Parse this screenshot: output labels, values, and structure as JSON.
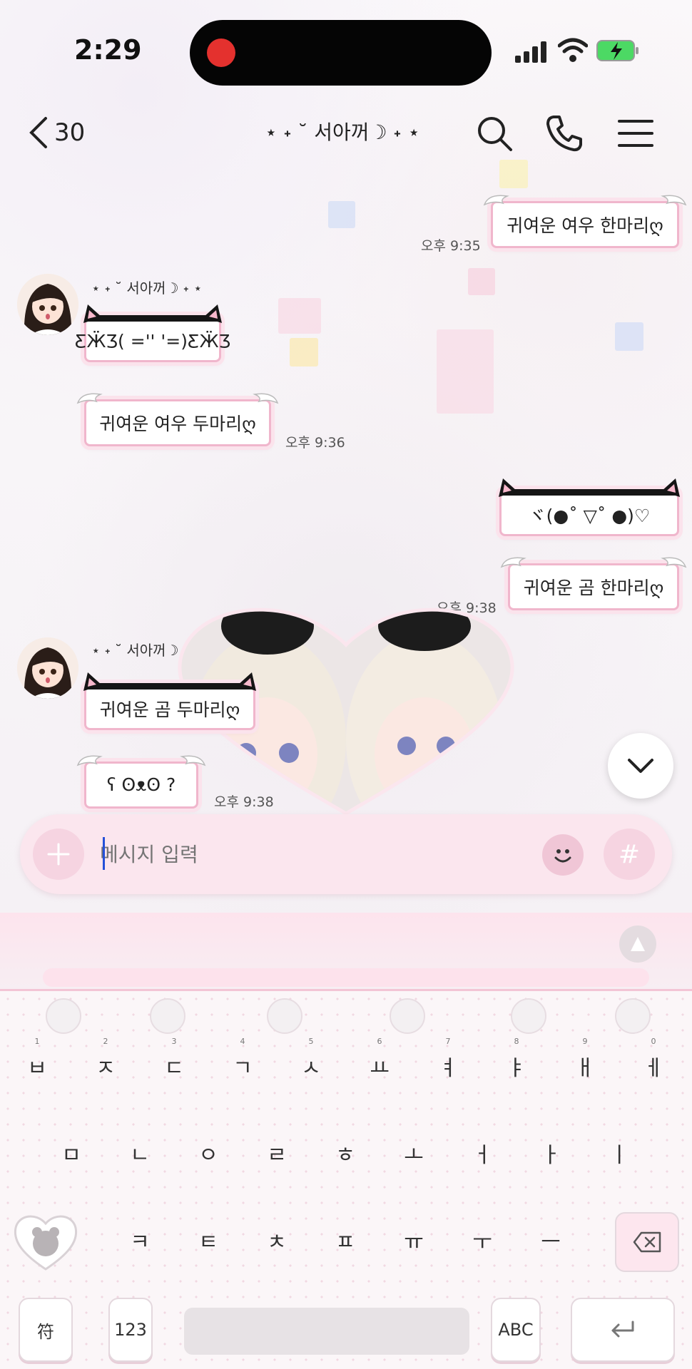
{
  "status_bar": {
    "time": "2:29"
  },
  "header": {
    "back_count": "30",
    "title": "⋆ ˖ ˘ 서아꺼☽ ˖ ⋆"
  },
  "messages": [
    {
      "id": "m1",
      "side": "right",
      "text": "귀여운 여우 한마리ღ",
      "time": "오후 9:35",
      "style": "wing"
    },
    {
      "id": "m2",
      "side": "left",
      "sender": "⋆ ˖ ˘ 서아꺼☽ ˖ ⋆",
      "text": "ƸӜƷ( ='' '=)ƸӜƷ",
      "style": "cat"
    },
    {
      "id": "m3",
      "side": "left",
      "text": "귀여운 여우 두마리ღ",
      "time": "오후 9:36",
      "style": "wing"
    },
    {
      "id": "m4",
      "side": "right",
      "text": "ヾ(●˚ ▽˚ ●)♡",
      "style": "cat"
    },
    {
      "id": "m5",
      "side": "right",
      "text": "귀여운 곰 한마리ღ",
      "time": "오후 9:38",
      "style": "wing"
    },
    {
      "id": "m6",
      "side": "left",
      "sender": "⋆ ˖ ˘ 서아꺼☽",
      "text": "귀여운 곰 두마리ღ",
      "style": "cat"
    },
    {
      "id": "m7",
      "side": "left",
      "text": "ʕ ʘᴥʘ ?",
      "time": "오후 9:38",
      "style": "wing"
    }
  ],
  "input": {
    "placeholder": "메시지 입력",
    "hash": "#"
  },
  "keyboard": {
    "row1": [
      {
        "hint": "1",
        "key": "ㅂ"
      },
      {
        "hint": "2",
        "key": "ㅈ"
      },
      {
        "hint": "3",
        "key": "ㄷ"
      },
      {
        "hint": "4",
        "key": "ㄱ"
      },
      {
        "hint": "5",
        "key": "ㅅ"
      },
      {
        "hint": "6",
        "key": "ㅛ"
      },
      {
        "hint": "7",
        "key": "ㅕ"
      },
      {
        "hint": "8",
        "key": "ㅑ"
      },
      {
        "hint": "9",
        "key": "ㅐ"
      },
      {
        "hint": "0",
        "key": "ㅔ"
      }
    ],
    "row2": [
      {
        "hint": "",
        "key": "ㅁ"
      },
      {
        "hint": "",
        "key": "ㄴ"
      },
      {
        "hint": "",
        "key": "ㅇ"
      },
      {
        "hint": "",
        "key": "ㄹ"
      },
      {
        "hint": "",
        "key": "ㅎ"
      },
      {
        "hint": "",
        "key": "ㅗ"
      },
      {
        "hint": "",
        "key": "ㅓ"
      },
      {
        "hint": "",
        "key": "ㅏ"
      },
      {
        "hint": "",
        "key": "ㅣ"
      }
    ],
    "row3": [
      {
        "hint": "",
        "key": "ㅋ"
      },
      {
        "hint": "",
        "key": "ㅌ"
      },
      {
        "hint": "",
        "key": "ㅊ"
      },
      {
        "hint": "",
        "key": "ㅍ"
      },
      {
        "hint": "",
        "key": "ㅠ"
      },
      {
        "hint": "",
        "key": "ㅜ"
      },
      {
        "hint": "",
        "key": "ㅡ"
      }
    ],
    "symbol_key": "符",
    "numeric_key": "123",
    "abc_key": "ABC"
  },
  "colors": {
    "accent_pink": "#f0b6cc",
    "input_bg": "#fbe6ee",
    "record_dot": "#e4312e",
    "battery_green": "#4cd964"
  }
}
